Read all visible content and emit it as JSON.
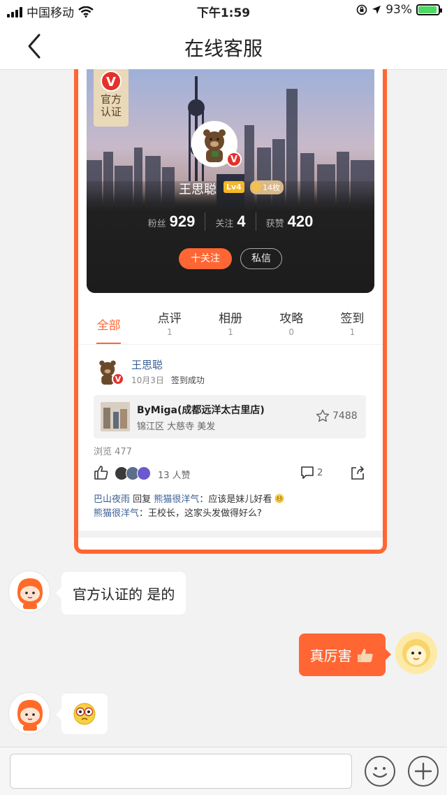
{
  "status_bar": {
    "carrier": "中国移动",
    "time": "下午1:59",
    "battery": "93%",
    "battery_level": 0.93
  },
  "nav": {
    "title": "在线客服"
  },
  "profile_card": {
    "official_badge": {
      "letter": "V",
      "line1": "官方",
      "line2": "认证"
    },
    "name": "王思聪",
    "level": "Lv4",
    "medals": "14枚",
    "stats": [
      {
        "label": "粉丝",
        "value": "929"
      },
      {
        "label": "关注",
        "value": "4"
      },
      {
        "label": "获赞",
        "value": "420"
      }
    ],
    "follow_label": "十关注",
    "message_label": "私信",
    "tabs": [
      {
        "label": "全部",
        "count": ""
      },
      {
        "label": "点评",
        "count": "1"
      },
      {
        "label": "相册",
        "count": "1"
      },
      {
        "label": "攻略",
        "count": "0"
      },
      {
        "label": "签到",
        "count": "1"
      }
    ],
    "post": {
      "author": "王思聪",
      "date": "10月3日",
      "action": "签到成功",
      "shop_name": "ByMiga(成都远洋太古里店)",
      "shop_sub": "锦江区 大慈寺 美发",
      "shop_stars": "7488",
      "views": "浏览 477",
      "likes": "13 人赞",
      "comment_count": "2",
      "comments": [
        {
          "user": "巴山夜雨",
          "reply_word": "回复",
          "to": "熊猫很洋气",
          "text": "：应该是妹儿好看"
        },
        {
          "user": "熊猫很洋气",
          "text": "：王校长，这家头发做得好么?"
        }
      ]
    }
  },
  "chat": {
    "messages": [
      {
        "side": "in",
        "text": "官方认证的 是的"
      },
      {
        "side": "out",
        "text": "真厉害"
      },
      {
        "side": "in",
        "text": ""
      }
    ]
  },
  "input_bar": {
    "placeholder": ""
  },
  "colors": {
    "accent": "#ff6633",
    "link": "#3a5f94",
    "verified": "#e4312b"
  }
}
